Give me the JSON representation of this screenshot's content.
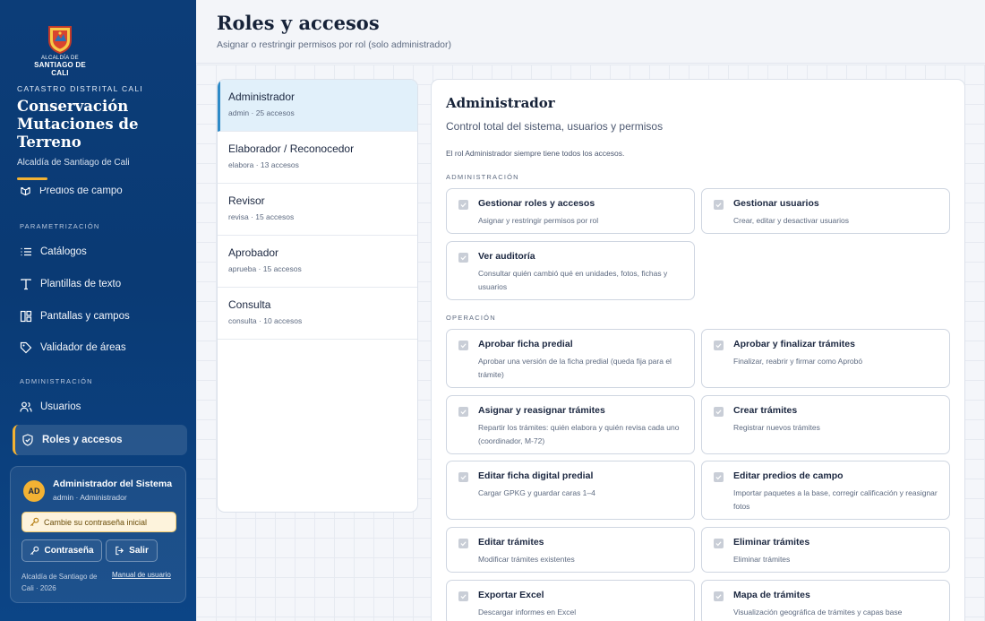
{
  "sidebar": {
    "logo_line1": "ALCALDÍA DE",
    "logo_line2": "SANTIAGO DE CALI",
    "kicker": "CATASTRO DISTRITAL CALI",
    "title": "Conservación Mutaciones de Terreno",
    "subtitle": "Alcaldía de Santiago de Cali",
    "partial_item": "Predios de campo",
    "sections": [
      {
        "label": "PARAMETRIZACIÓN",
        "items": [
          {
            "label": "Catálogos",
            "icon": "list-icon"
          },
          {
            "label": "Plantillas de texto",
            "icon": "text-icon"
          },
          {
            "label": "Pantallas y campos",
            "icon": "layout-icon"
          },
          {
            "label": "Validador de áreas",
            "icon": "tag-icon"
          }
        ]
      },
      {
        "label": "ADMINISTRACIÓN",
        "items": [
          {
            "label": "Usuarios",
            "icon": "users-icon"
          },
          {
            "label": "Roles y accesos",
            "icon": "shield-icon",
            "active": true
          }
        ]
      }
    ],
    "user": {
      "initials": "AD",
      "name": "Administrador del Sistema",
      "role": "admin · Administrador",
      "warning": "Cambie su contraseña inicial",
      "password_button": "Contraseña",
      "logout_button": "Salir",
      "footer": "Alcaldía de Santiago de Cali · 2026",
      "manual_link": "Manual de usuario"
    }
  },
  "header": {
    "title": "Roles y accesos",
    "subtitle": "Asignar o restringir permisos por rol (solo administrador)"
  },
  "roles": [
    {
      "name": "Administrador",
      "meta": "admin · 25 accesos",
      "active": true
    },
    {
      "name": "Elaborador / Reconocedor",
      "meta": "elabora · 13 accesos"
    },
    {
      "name": "Revisor",
      "meta": "revisa · 15 accesos"
    },
    {
      "name": "Aprobador",
      "meta": "aprueba · 15 accesos"
    },
    {
      "name": "Consulta",
      "meta": "consulta · 10 accesos"
    }
  ],
  "detail": {
    "title": "Administrador",
    "description": "Control total del sistema, usuarios y permisos",
    "note": "El rol Administrador siempre tiene todos los accesos.",
    "sections": [
      {
        "label": "ADMINISTRACIÓN",
        "permissions": [
          {
            "title": "Gestionar roles y accesos",
            "desc": "Asignar y restringir permisos por rol",
            "checked": true
          },
          {
            "title": "Gestionar usuarios",
            "desc": "Crear, editar y desactivar usuarios",
            "checked": true
          },
          {
            "title": "Ver auditoría",
            "desc": "Consultar quién cambió qué en unidades, fotos, fichas y usuarios",
            "checked": true
          }
        ]
      },
      {
        "label": "OPERACIÓN",
        "permissions": [
          {
            "title": "Aprobar ficha predial",
            "desc": "Aprobar una versión de la ficha predial (queda fija para el trámite)",
            "checked": true
          },
          {
            "title": "Aprobar y finalizar trámites",
            "desc": "Finalizar, reabrir y firmar como Aprobó",
            "checked": true
          },
          {
            "title": "Asignar y reasignar trámites",
            "desc": "Repartir los trámites: quién elabora y quién revisa cada uno (coordinador, M-72)",
            "checked": true
          },
          {
            "title": "Crear trámites",
            "desc": "Registrar nuevos trámites",
            "checked": true
          },
          {
            "title": "Editar ficha digital predial",
            "desc": "Cargar GPKG y guardar caras 1–4",
            "checked": true
          },
          {
            "title": "Editar predios de campo",
            "desc": "Importar paquetes a la base, corregir calificación y reasignar fotos",
            "checked": true
          },
          {
            "title": "Editar trámites",
            "desc": "Modificar trámites existentes",
            "checked": true
          },
          {
            "title": "Eliminar trámites",
            "desc": "Eliminar trámites",
            "checked": true
          },
          {
            "title": "Exportar Excel",
            "desc": "Descargar informes en Excel",
            "checked": true
          },
          {
            "title": "Mapa de trámites",
            "desc": "Visualización geográfica de trámites y capas base",
            "checked": true
          }
        ]
      }
    ]
  },
  "colors": {
    "sidebar": "#0c3d78",
    "accent": "#f3b233",
    "active_role": "#e1f0fa",
    "active_role_border": "#2e8ac7"
  }
}
